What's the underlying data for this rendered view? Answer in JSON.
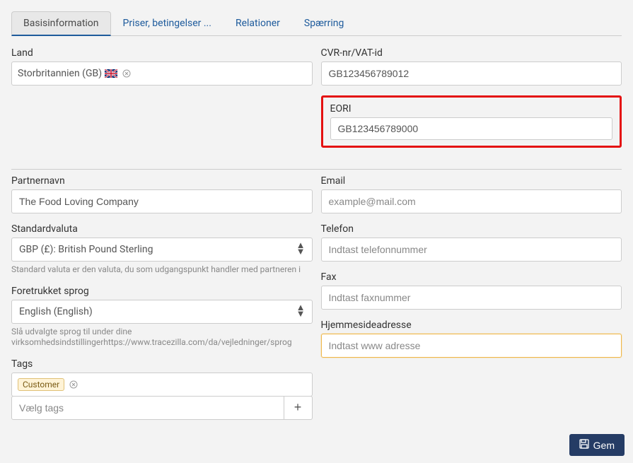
{
  "tabs": [
    {
      "label": "Basisinformation",
      "active": true
    },
    {
      "label": "Priser, betingelser ...",
      "active": false
    },
    {
      "label": "Relationer",
      "active": false
    },
    {
      "label": "Spærring",
      "active": false
    }
  ],
  "left": {
    "country": {
      "label": "Land",
      "value": "Storbritannien (GB)"
    },
    "partnerName": {
      "label": "Partnernavn",
      "value": "The Food Loving Company"
    },
    "defaultCurrency": {
      "label": "Standardvaluta",
      "value": "GBP (£): British Pound Sterling",
      "hint": "Standard valuta er den valuta, du som udgangspunkt handler med partneren i"
    },
    "preferredLanguage": {
      "label": "Foretrukket sprog",
      "value": "English (English)",
      "hint": "Slå udvalgte sprog til under dine virksomhedsindstillingerhttps://www.tracezilla.com/da/vejledninger/sprog"
    },
    "tags": {
      "label": "Tags",
      "chip": "Customer",
      "placeholder": "Vælg tags"
    }
  },
  "right": {
    "vat": {
      "label": "CVR-nr/VAT-id",
      "value": "GB123456789012"
    },
    "eori": {
      "label": "EORI",
      "value": "GB123456789000"
    },
    "email": {
      "label": "Email",
      "placeholder": "example@mail.com"
    },
    "phone": {
      "label": "Telefon",
      "placeholder": "Indtast telefonnummer"
    },
    "fax": {
      "label": "Fax",
      "placeholder": "Indtast faxnummer"
    },
    "website": {
      "label": "Hjemmesideadresse",
      "placeholder": "Indtast www adresse"
    }
  },
  "saveButton": "Gem"
}
